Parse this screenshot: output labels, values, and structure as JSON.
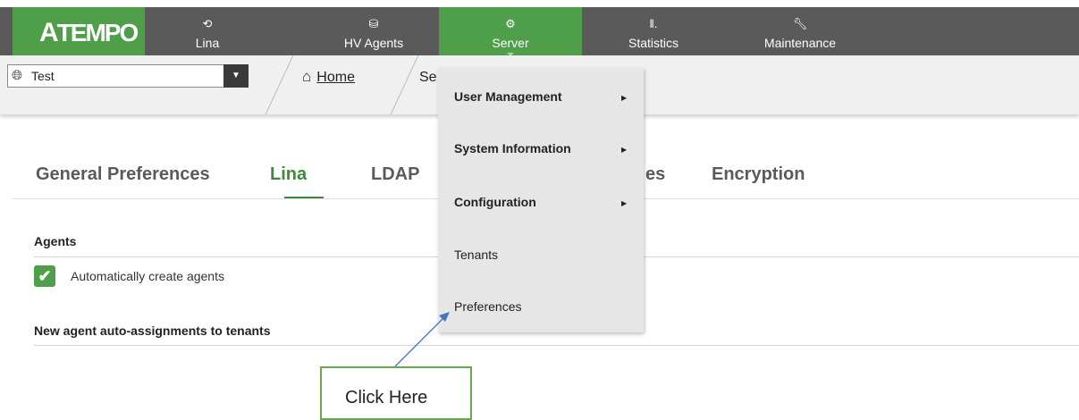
{
  "topnav": {
    "logo": "ATEMPO",
    "items": [
      {
        "label": "Lina",
        "icon": "history-icon"
      },
      {
        "label": "HV Agents",
        "icon": "database-icon"
      },
      {
        "label": "Server",
        "icon": "gear-icon"
      },
      {
        "label": "Statistics",
        "icon": "bar-chart-icon"
      },
      {
        "label": "Maintenance",
        "icon": "wrench-icon"
      }
    ],
    "active": "Server",
    "colors": {
      "bar": "#5a5a5a",
      "accent": "#4f9e49"
    }
  },
  "breadcrumb": {
    "tenant_value": "Test",
    "home": "Home",
    "current": "Se"
  },
  "tabs": [
    "General Preferences",
    "Lina",
    "LDAP",
    "es",
    "Encryption"
  ],
  "active_tab": "Lina",
  "sections": {
    "agents_title": "Agents",
    "auto_create_label": "Automatically create agents",
    "auto_create_checked": true,
    "auto_assign_title": "New agent auto-assignments to tenants"
  },
  "server_menu": {
    "items": [
      {
        "label": "User Management",
        "submenu": true
      },
      {
        "label": "System Information",
        "submenu": true
      },
      {
        "label": "Configuration",
        "submenu": true
      },
      {
        "label": "Tenants",
        "submenu": false
      },
      {
        "label": "Preferences",
        "submenu": false
      }
    ]
  },
  "annotation": {
    "text": "Click Here",
    "color": "#6aa84f",
    "arrow_color": "#4472c4"
  }
}
